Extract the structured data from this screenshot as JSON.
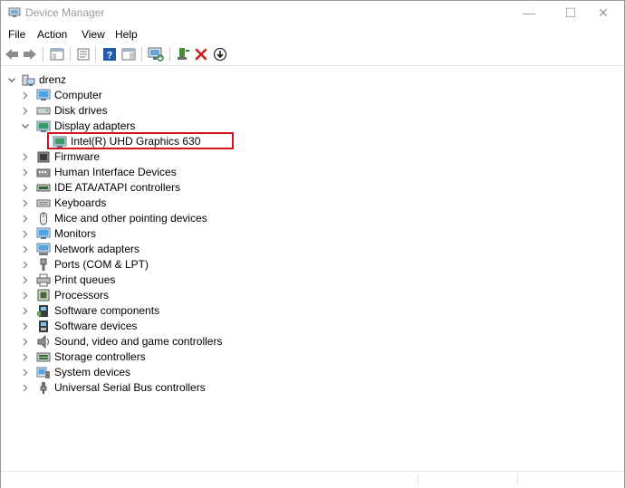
{
  "window": {
    "title": "Device Manager",
    "minimize_glyph": "—",
    "maximize_glyph": "☐",
    "close_glyph": "✕"
  },
  "menu": {
    "file": "File",
    "action": "Action",
    "view": "View",
    "help": "Help"
  },
  "toolbar": {
    "icons": [
      "back-arrow-icon",
      "forward-arrow-icon",
      "show-hide-console-tree-icon",
      "properties-icon",
      "help-icon",
      "action-pane-icon",
      "scan-hardware-changes-icon",
      "add-driver-icon",
      "uninstall-device-icon",
      "update-driver-icon"
    ]
  },
  "tree": {
    "root": "drenz",
    "items": [
      {
        "label": "Computer",
        "icon": "computer-icon"
      },
      {
        "label": "Disk drives",
        "icon": "disk-drive-icon"
      },
      {
        "label": "Display adapters",
        "icon": "display-adapter-icon",
        "expanded": true
      },
      {
        "label": "Intel(R) UHD Graphics 630",
        "icon": "display-adapter-icon",
        "child": true
      },
      {
        "label": "Firmware",
        "icon": "firmware-icon"
      },
      {
        "label": "Human Interface Devices",
        "icon": "hid-icon"
      },
      {
        "label": "IDE ATA/ATAPI controllers",
        "icon": "ide-controller-icon"
      },
      {
        "label": "Keyboards",
        "icon": "keyboard-icon"
      },
      {
        "label": "Mice and other pointing devices",
        "icon": "mouse-icon"
      },
      {
        "label": "Monitors",
        "icon": "monitor-icon"
      },
      {
        "label": "Network adapters",
        "icon": "network-adapter-icon"
      },
      {
        "label": "Ports (COM & LPT)",
        "icon": "port-icon"
      },
      {
        "label": "Print queues",
        "icon": "printer-icon"
      },
      {
        "label": "Processors",
        "icon": "processor-icon"
      },
      {
        "label": "Software components",
        "icon": "software-component-icon"
      },
      {
        "label": "Software devices",
        "icon": "software-device-icon"
      },
      {
        "label": "Sound, video and game controllers",
        "icon": "speaker-icon"
      },
      {
        "label": "Storage controllers",
        "icon": "storage-controller-icon"
      },
      {
        "label": "System devices",
        "icon": "system-device-icon"
      },
      {
        "label": "Universal Serial Bus controllers",
        "icon": "usb-icon"
      }
    ]
  },
  "colors": {
    "highlight_border": "#d0141e"
  }
}
